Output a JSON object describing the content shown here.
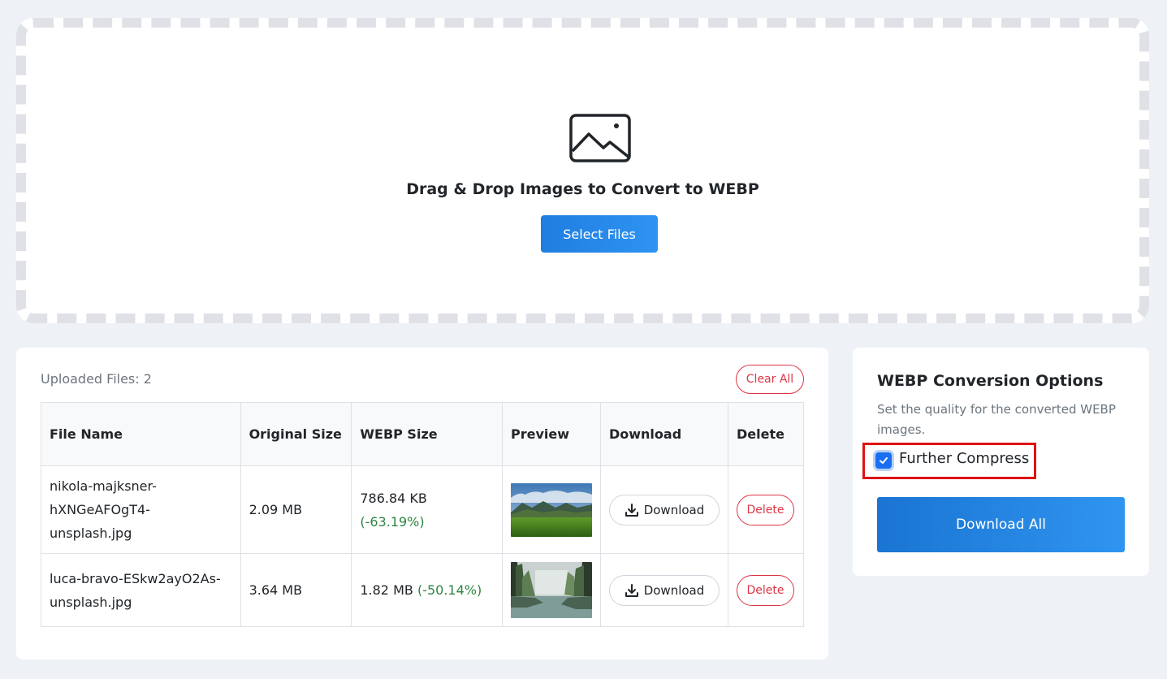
{
  "dropzone": {
    "icon": "image-icon",
    "title": "Drag & Drop Images to Convert to WEBP",
    "select_button": "Select Files"
  },
  "files": {
    "count_label": "Uploaded Files: 2",
    "clear_all": "Clear All",
    "columns": [
      "File Name",
      "Original Size",
      "WEBP Size",
      "Preview",
      "Download",
      "Delete"
    ],
    "rows": [
      {
        "file_name": "nikola-majksner-hXNGeAFOgT4-unsplash.jpg",
        "original_size": "2.09 MB",
        "webp_size": "786.84 KB",
        "savings": "(-63.19%)",
        "preview": "mountain-meadow-thumbnail",
        "download": "Download",
        "delete": "Delete"
      },
      {
        "file_name": "luca-bravo-ESkw2ayO2As-unsplash.jpg",
        "original_size": "3.64 MB",
        "webp_size": "1.82 MB",
        "savings": "(-50.14%)",
        "preview": "forest-lake-thumbnail",
        "download": "Download",
        "delete": "Delete"
      }
    ]
  },
  "options": {
    "title": "WEBP Conversion Options",
    "description": "Set the quality for the converted WEBP images.",
    "further_compress_label": "Further Compress",
    "further_compress_checked": true,
    "download_all": "Download All"
  },
  "colors": {
    "primary": "#1f7ee0",
    "danger": "#dc3545",
    "success": "#2e8540",
    "highlight": "#e01212"
  }
}
